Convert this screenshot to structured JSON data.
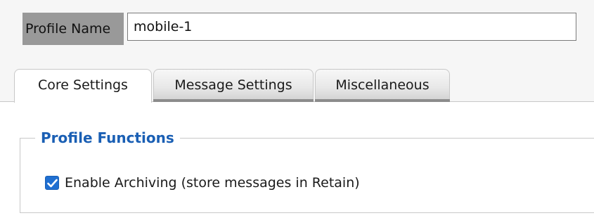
{
  "profile": {
    "label": "Profile Name",
    "name_value": "mobile-1"
  },
  "tabs": [
    {
      "label": "Core Settings",
      "active": true
    },
    {
      "label": "Message Settings",
      "active": false
    },
    {
      "label": "Miscellaneous",
      "active": false
    }
  ],
  "profile_functions": {
    "legend": "Profile Functions",
    "enable_archiving": {
      "label": "Enable Archiving (store messages in Retain)",
      "checked": true
    }
  },
  "colors": {
    "legend_blue": "#1a5fb4",
    "checkbox_blue": "#1f6fd1",
    "label_bg": "#999999"
  },
  "icons": {
    "checkbox_check": "checkmark-icon"
  }
}
